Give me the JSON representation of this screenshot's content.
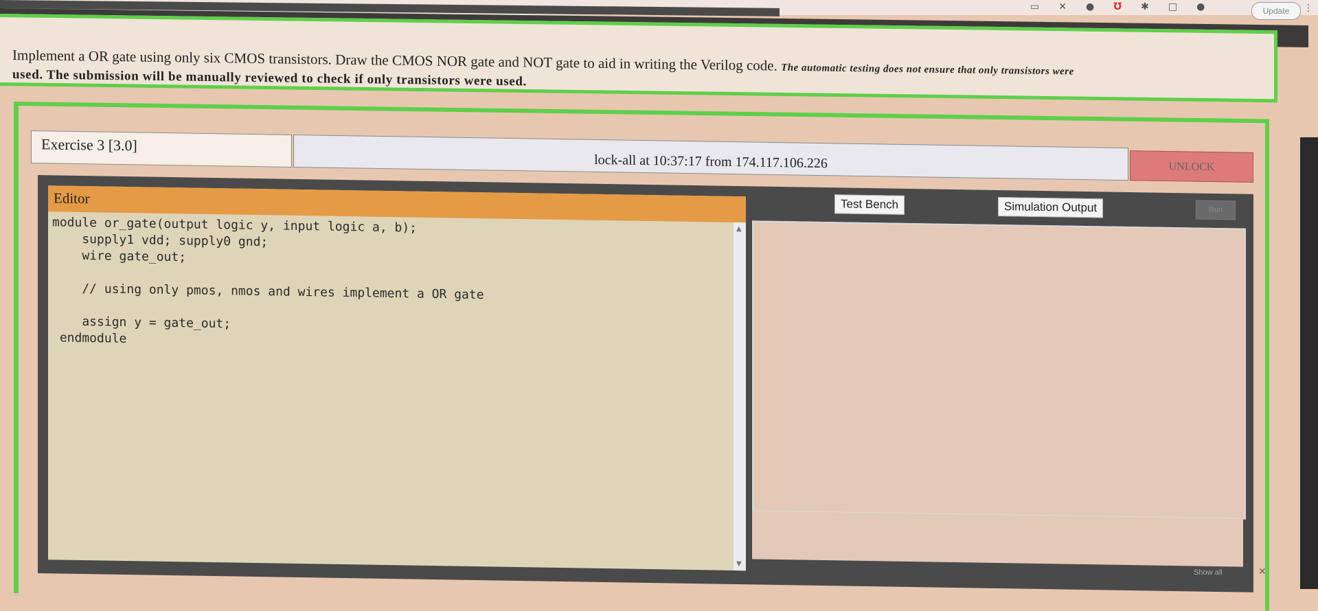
{
  "browser": {
    "update_label": "Update",
    "menu_glyph": "⋮"
  },
  "question": {
    "line1_plain": "Implement a OR gate using only six CMOS transistors. Draw the CMOS NOR gate and NOT gate to aid in writing the Verilog code.",
    "line1_bold": "The automatic testing does not ensure that only transistors were",
    "line2": "used. The submission will be manually reviewed to check if only transistors were used."
  },
  "exercise": {
    "title": "Exercise 3 [3.0]",
    "lock_status": "lock-all at 10:37:17 from 174.117.106.226",
    "unlock_label": "UNLOCK"
  },
  "editor": {
    "header": "Editor",
    "code": "module or_gate(output logic y, input logic a, b);\n    supply1 vdd; supply0 gnd;\n    wire gate_out;\n\n    // using only pmos, nmos and wires implement a OR gate\n\n    assign y = gate_out;\n endmodule"
  },
  "tabs": {
    "test_bench": "Test Bench",
    "simulation_output": "Simulation Output",
    "run": "Run"
  },
  "footer": {
    "show_all": "Show all",
    "close": "✕"
  }
}
